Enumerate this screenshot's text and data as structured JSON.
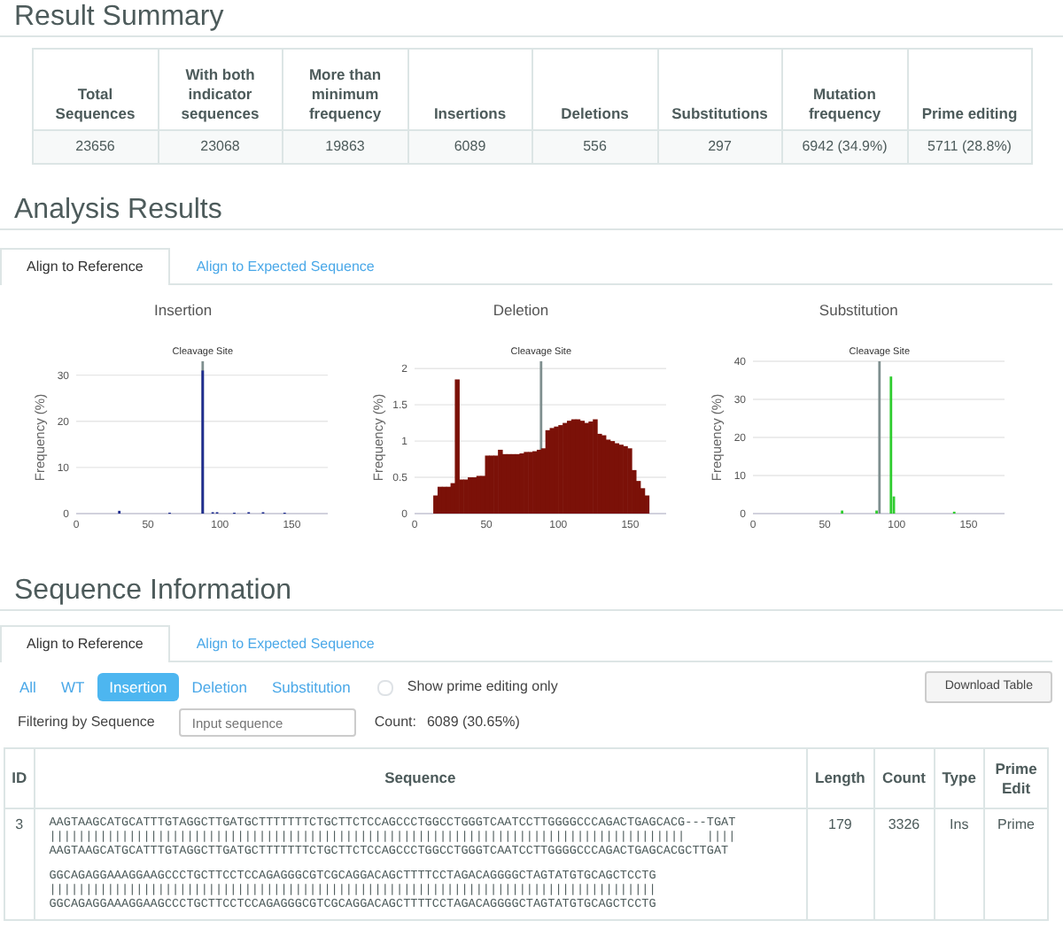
{
  "result_summary": {
    "title": "Result Summary",
    "columns": [
      "Total Sequences",
      "With both indicator sequences",
      "More than minimum frequency",
      "Insertions",
      "Deletions",
      "Substitutions",
      "Mutation frequency",
      "Prime editing"
    ],
    "values": [
      "23656",
      "23068",
      "19863",
      "6089",
      "556",
      "297",
      "6942 (34.9%)",
      "5711 (28.8%)"
    ]
  },
  "analysis_results": {
    "title": "Analysis Results",
    "tabs": [
      {
        "label": "Align to Reference",
        "selected": true
      },
      {
        "label": "Align to Expected Sequence",
        "selected": false
      }
    ],
    "charts": [
      {
        "chart_data": {
          "type": "bar",
          "title": "Insertion",
          "ylabel": "Frequency (%)",
          "xlim": [
            0,
            175
          ],
          "xticks": [
            0,
            50,
            100,
            150
          ],
          "ylim": [
            0,
            33
          ],
          "yticks": [
            0,
            10,
            20,
            30
          ],
          "grid": true,
          "ref_lines": [
            {
              "axis": "x",
              "value": 88,
              "label": "Cleavage Site"
            }
          ],
          "x": [
            30,
            65,
            88,
            95,
            98,
            110,
            120,
            130,
            145
          ],
          "series": [
            {
              "color": "#1f2d8f",
              "values": [
                0.6,
                0.2,
                31,
                0.3,
                0.3,
                0.2,
                0.3,
                0.3,
                0.2
              ]
            }
          ]
        }
      },
      {
        "chart_data": {
          "type": "bar",
          "title": "Deletion",
          "ylabel": "Frequency (%)",
          "xlim": [
            0,
            175
          ],
          "xticks": [
            0,
            50,
            100,
            150
          ],
          "ylim": [
            0,
            2.1
          ],
          "yticks": [
            0,
            0.5,
            1,
            1.5,
            2
          ],
          "grid": true,
          "ref_lines": [
            {
              "axis": "x",
              "value": 88,
              "label": "Cleavage Site"
            }
          ],
          "x": [
            13,
            16,
            19,
            22,
            25,
            28,
            31,
            34,
            37,
            40,
            43,
            46,
            49,
            52,
            55,
            58,
            61,
            64,
            67,
            70,
            73,
            76,
            79,
            82,
            85,
            88,
            91,
            94,
            97,
            100,
            103,
            106,
            109,
            112,
            115,
            118,
            121,
            124,
            127,
            130,
            133,
            136,
            139,
            142,
            145,
            148,
            151,
            154,
            157,
            160
          ],
          "series": [
            {
              "color": "#7b1108",
              "values": [
                0.25,
                0.37,
                0.37,
                0.37,
                0.42,
                1.85,
                0.47,
                0.47,
                0.5,
                0.5,
                0.52,
                0.52,
                0.8,
                0.8,
                0.8,
                0.88,
                0.82,
                0.82,
                0.82,
                0.82,
                0.83,
                0.85,
                0.85,
                0.86,
                0.88,
                0.9,
                1.15,
                1.18,
                1.2,
                1.22,
                1.25,
                1.28,
                1.3,
                1.3,
                1.28,
                1.25,
                1.27,
                1.3,
                1.1,
                1.08,
                1.02,
                1.0,
                0.97,
                0.95,
                0.93,
                0.9,
                0.6,
                0.45,
                0.35,
                0.25
              ]
            }
          ]
        }
      },
      {
        "chart_data": {
          "type": "bar",
          "title": "Substitution",
          "ylabel": "Frequency (%)",
          "xlim": [
            0,
            175
          ],
          "ylim": [
            0,
            40
          ],
          "xticks": [
            0,
            50,
            100,
            150
          ],
          "yticks": [
            0,
            10,
            20,
            30,
            40
          ],
          "grid": true,
          "ref_lines": [
            {
              "axis": "x",
              "value": 88,
              "label": "Cleavage Site"
            }
          ],
          "x": [
            62,
            86,
            96,
            98,
            140
          ],
          "series": [
            {
              "color": "#2fcc2f",
              "values": [
                0.8,
                0.8,
                36,
                4.5,
                0.5
              ]
            }
          ]
        }
      }
    ]
  },
  "sequence_information": {
    "title": "Sequence Information",
    "tabs": [
      {
        "label": "Align to Reference",
        "selected": true
      },
      {
        "label": "Align to Expected Sequence",
        "selected": false
      }
    ],
    "filters": [
      {
        "label": "All",
        "selected": false
      },
      {
        "label": "WT",
        "selected": false
      },
      {
        "label": "Insertion",
        "selected": true
      },
      {
        "label": "Deletion",
        "selected": false
      },
      {
        "label": "Substitution",
        "selected": false
      }
    ],
    "prime_only": {
      "label": "Show prime editing only",
      "checked": false
    },
    "download_button": "Download Table",
    "filter_label": "Filtering by Sequence",
    "filter_field": {
      "placeholder": "Input sequence"
    },
    "count_label": "Count:",
    "count_value": "6089 (30.65%)",
    "table": {
      "columns": [
        "ID",
        "Sequence",
        "Length",
        "Count",
        "Type",
        "Prime Edit"
      ],
      "rows": [
        {
          "id": "3",
          "blocks": [
            [
              "AAGTAAGCATGCATTTGTAGGCTTGATGCTTTTTTTCTGCTTCTCCAGCCCTGGCCTGGGTCAATCCTTGGGGCCCAGACTGAGCACG---TGAT",
              "||||||||||||||||||||||||||||||||||||||||||||||||||||||||||||||||||||||||||||||||||||||||   ||||",
              "AAGTAAGCATGCATTTGTAGGCTTGATGCTTTTTTTCTGCTTCTCCAGCCCTGGCCTGGGTCAATCCTTGGGGCCCAGACTGAGCACGCTTGAT"
            ],
            [
              "GGCAGAGGAAAGGAAGCCCTGCTTCCTCCAGAGGGCGTCGCAGGACAGCTTTTCCTAGACAGGGGCTAGTATGTGCAGCTCCTG",
              "||||||||||||||||||||||||||||||||||||||||||||||||||||||||||||||||||||||||||||||||||||",
              "GGCAGAGGAAAGGAAGCCCTGCTTCCTCCAGAGGGCGTCGCAGGACAGCTTTTCCTAGACAGGGGCTAGTATGTGCAGCTCCTG"
            ]
          ],
          "length": "179",
          "count": "3326",
          "type": "Ins",
          "prime_edit": "Prime"
        }
      ]
    }
  }
}
